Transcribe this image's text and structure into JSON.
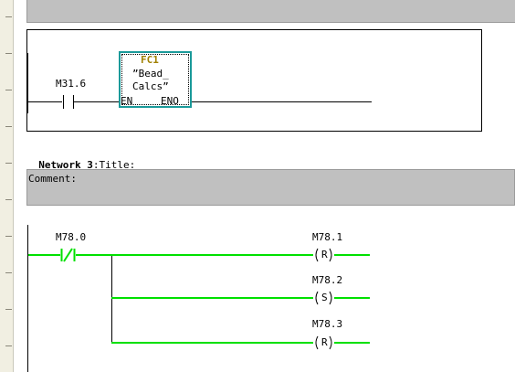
{
  "network2": {
    "contact_label": "M31.6",
    "block_name": "FC1",
    "block_comment_line1": "”Bead_",
    "block_comment_line2": "Calcs”",
    "pin_en": "EN",
    "pin_eno": "ENO",
    "block_name_color": "#a08000",
    "block_border_color": "#1a9a9a"
  },
  "network3": {
    "label": "Network 3",
    "separator": ":",
    "title": "Title:",
    "comment_label": "Comment:",
    "contact_label": "M78.0",
    "coils": [
      {
        "label": "M78.1",
        "type": "R"
      },
      {
        "label": "M78.2",
        "type": "S"
      },
      {
        "label": "M78.3",
        "type": "R"
      }
    ],
    "energized_color": "#00e000"
  }
}
